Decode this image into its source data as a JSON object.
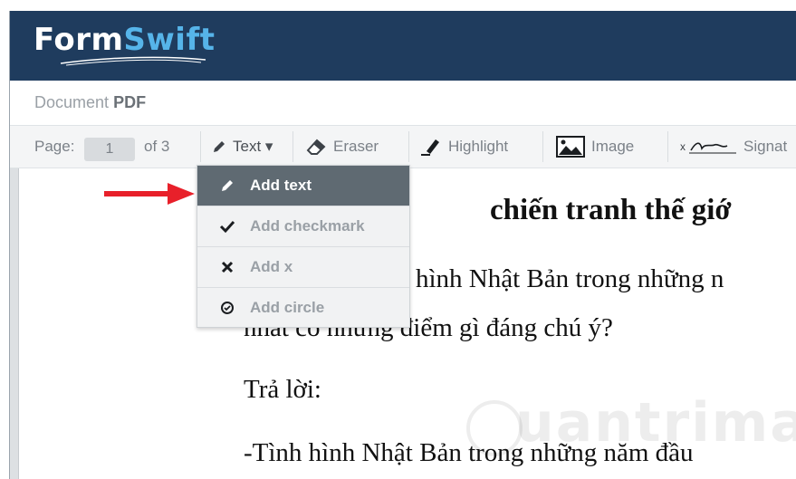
{
  "app": {
    "logo_text_a": "Form",
    "logo_text_b": "Swift",
    "brand_color": "#1f3c5e",
    "accent_color": "#56b4e9"
  },
  "document": {
    "title_prefix": "Document",
    "title_type": "PDF"
  },
  "toolbar": {
    "page_label": "Page:",
    "page_current": "1",
    "page_of": "of 3",
    "text_label": "Text ▾",
    "eraser_label": "Eraser",
    "highlight_label": "Highlight",
    "image_label": "Image",
    "signature_prefix": "x",
    "signature_label": "Signat"
  },
  "text_menu": {
    "items": [
      {
        "label": "Add text",
        "icon": "pencil-icon",
        "active": true
      },
      {
        "label": "Add checkmark",
        "icon": "checkmark-icon",
        "active": false
      },
      {
        "label": "Add x",
        "icon": "x-icon",
        "active": false
      },
      {
        "label": "Add circle",
        "icon": "circle-check-icon",
        "active": false
      }
    ]
  },
  "page_content": {
    "heading": "chiến tranh thế giớ",
    "line1": "hình Nhật Bản trong những n",
    "line2": "nhất có những điểm gì đáng chú ý?",
    "line3": "Trả lời:",
    "line4": "-Tình hình Nhật Bản trong những năm đầu"
  },
  "watermark": "uantrimang",
  "annotation": {
    "arrow_color": "#e8202a"
  }
}
